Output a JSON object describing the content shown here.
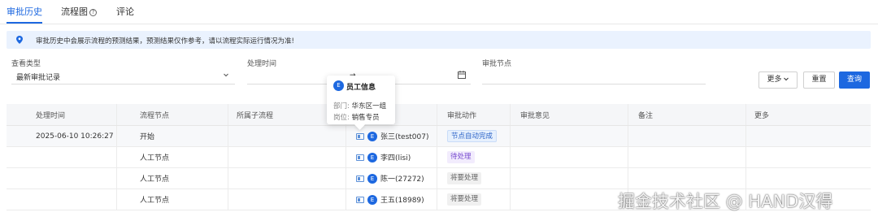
{
  "tabs": [
    {
      "label": "审批历史"
    },
    {
      "label": "流程图"
    },
    {
      "label": "评论"
    }
  ],
  "alert": {
    "text": "审批历史中会展示流程的预测结果，预测结果仅作参考，请以流程实际运行情况为准!"
  },
  "filters": {
    "view_type": {
      "label": "查看类型",
      "value": "最新审批记录"
    },
    "process_time": {
      "label": "处理时间",
      "value": "→"
    },
    "approval_node": {
      "label": "审批节点",
      "value": ""
    }
  },
  "buttons": {
    "more": "更多",
    "reset": "重置",
    "query": "查询"
  },
  "table": {
    "columns": [
      "处理时间",
      "流程节点",
      "所属子流程",
      "",
      "审批动作",
      "审批意见",
      "备注",
      "更多"
    ],
    "rows": [
      {
        "time": "2025-06-10 10:26:27",
        "node": "开始",
        "subflow": "",
        "avatar": "E",
        "user": "张三(test007)",
        "action": "节点自动完成",
        "tag": "blue"
      },
      {
        "time": "",
        "node": "人工节点",
        "subflow": "",
        "avatar": "E",
        "user": "李四(lisi)",
        "action": "待处理",
        "tag": "purple"
      },
      {
        "time": "",
        "node": "人工节点",
        "subflow": "",
        "avatar": "E",
        "user": "陈一(27272)",
        "action": "将要处理",
        "tag": "gray"
      },
      {
        "time": "",
        "node": "人工节点",
        "subflow": "",
        "avatar": "E",
        "user": "王五(18989)",
        "action": "将要处理",
        "tag": "gray"
      }
    ]
  },
  "popover": {
    "avatar": "E",
    "title": "员工信息",
    "dept_label": "部门:",
    "dept_value": "华东区一组",
    "post_label": "岗位:",
    "post_value": "销售专员"
  },
  "watermark": "掘金技术社区 @ HAND汉得",
  "colors": {
    "primary": "#1d68e0",
    "alert_bg": "#eaf2fe"
  }
}
